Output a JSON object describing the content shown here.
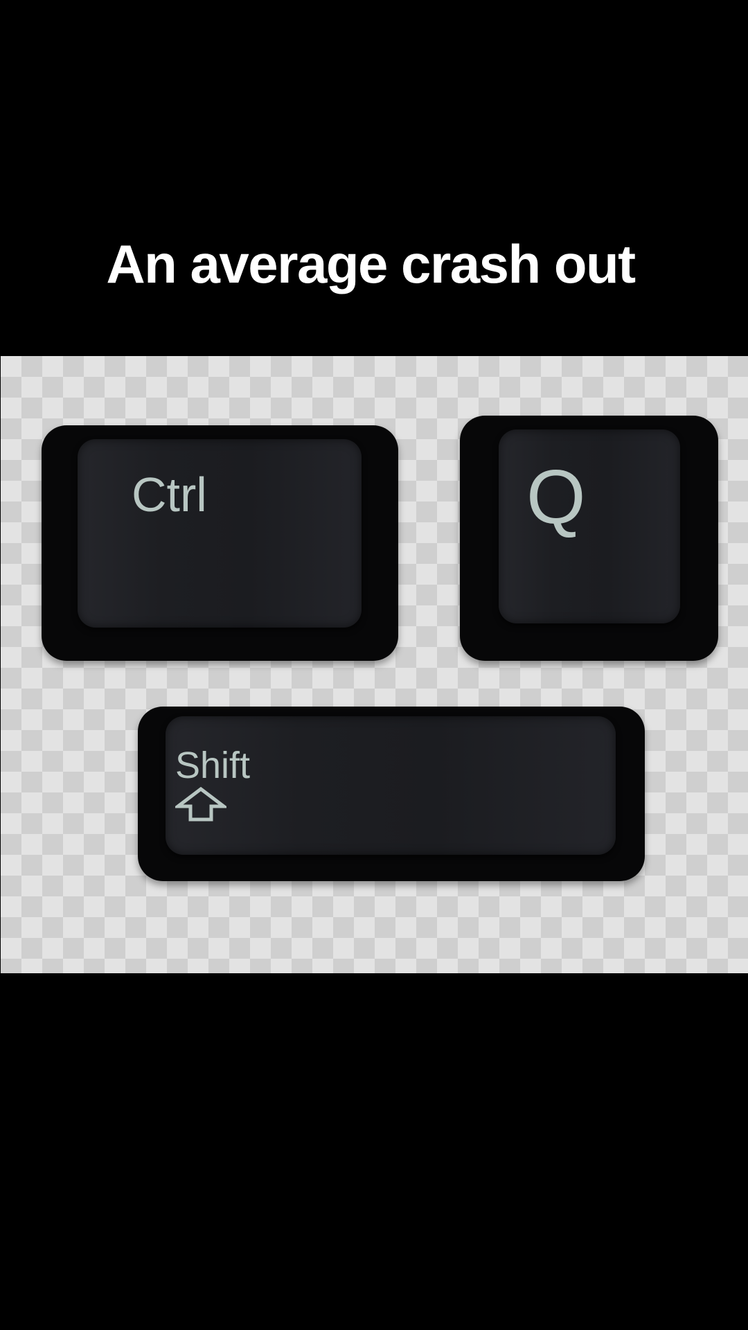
{
  "caption": {
    "text": "An average crash out"
  },
  "keys": {
    "ctrl": {
      "label": "Ctrl"
    },
    "q": {
      "label": "Q"
    },
    "shift": {
      "label": "Shift",
      "icon": "shift-arrow-icon"
    }
  },
  "colors": {
    "background": "#000000",
    "caption_text": "#ffffff",
    "checker_light": "#e3e3e3",
    "checker_dark": "#cfcfcf",
    "keycap": "#1d1e22",
    "legend": "#b8c6c2"
  }
}
